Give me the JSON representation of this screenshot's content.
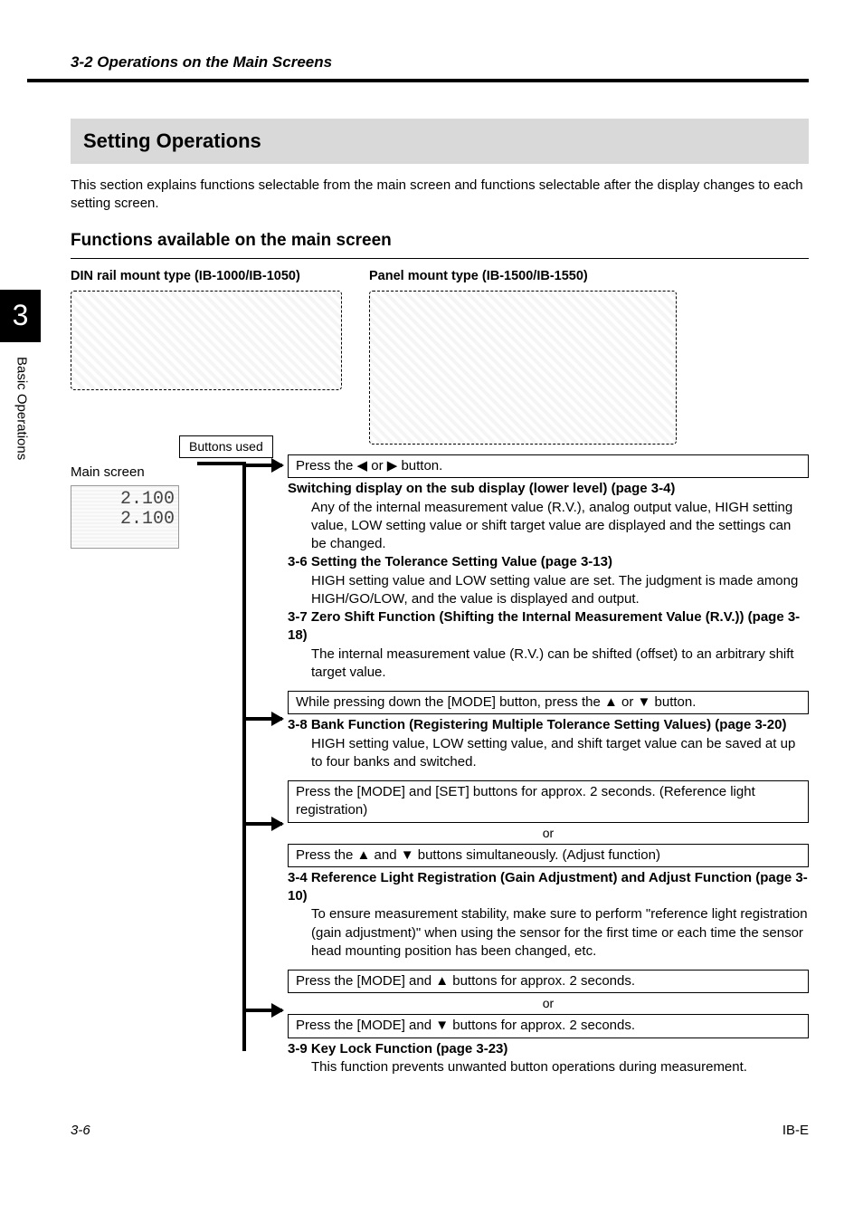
{
  "header": {
    "section": "3-2  Operations on the Main Screens"
  },
  "tab": {
    "number": "3",
    "label": "Basic Operations"
  },
  "title": "Setting Operations",
  "intro": "This section explains functions selectable from the main screen and functions selectable after the display changes to each setting screen.",
  "subhead": "Functions available on the main screen",
  "colA": "DIN rail mount type (IB-1000/IB-1050)",
  "colB": "Panel mount type (IB-1500/IB-1550)",
  "buttons_used": "Buttons used",
  "main_screen_label": "Main screen",
  "main_screen_values": {
    "top": "2.100",
    "bottom": "2.100"
  },
  "flow": [
    {
      "action": "Press the ◀ or ▶ button.",
      "items": [
        {
          "title": "Switching display on the sub display (lower level) (page 3-4)",
          "body": "Any of the internal measurement value (R.V.), analog output value, HIGH setting value, LOW setting value or shift target value are displayed and the settings can be changed."
        },
        {
          "title": "3-6 Setting the Tolerance Setting Value (page 3-13)",
          "body": "HIGH setting value and LOW setting value are set. The judgment is made among HIGH/GO/LOW, and the value is displayed and output."
        },
        {
          "title": "3-7 Zero Shift Function (Shifting the Internal Measurement Value (R.V.)) (page 3-18)",
          "body": "The internal measurement value (R.V.) can be shifted (offset) to an arbitrary shift target value."
        }
      ]
    },
    {
      "action": "While pressing down the [MODE] button, press the ▲ or ▼ button.",
      "items": [
        {
          "title": "3-8 Bank Function (Registering Multiple Tolerance Setting Values) (page 3-20)",
          "body": "HIGH setting value, LOW setting value, and shift target value can be saved at up to four banks and switched."
        }
      ]
    },
    {
      "action": "Press the [MODE] and [SET] buttons for approx. 2 seconds. (Reference light registration)",
      "or": "or",
      "action2": "Press the ▲ and ▼ buttons simultaneously. (Adjust function)",
      "items": [
        {
          "title": "3-4 Reference Light Registration (Gain Adjustment) and Adjust Function (page 3-10)",
          "body": "To ensure measurement stability, make sure to perform \"reference light registration (gain adjustment)\" when using the sensor for the first time or each time the sensor head mounting position has been changed, etc."
        }
      ]
    },
    {
      "action": "Press the [MODE] and ▲ buttons for approx. 2 seconds.",
      "or": "or",
      "action2": "Press the [MODE] and ▼ buttons for approx. 2 seconds.",
      "items": [
        {
          "title": "3-9 Key Lock Function (page 3-23)",
          "body": "This function prevents unwanted button operations during measurement."
        }
      ]
    }
  ],
  "footer": {
    "page": "3-6",
    "doc": "IB-E"
  }
}
